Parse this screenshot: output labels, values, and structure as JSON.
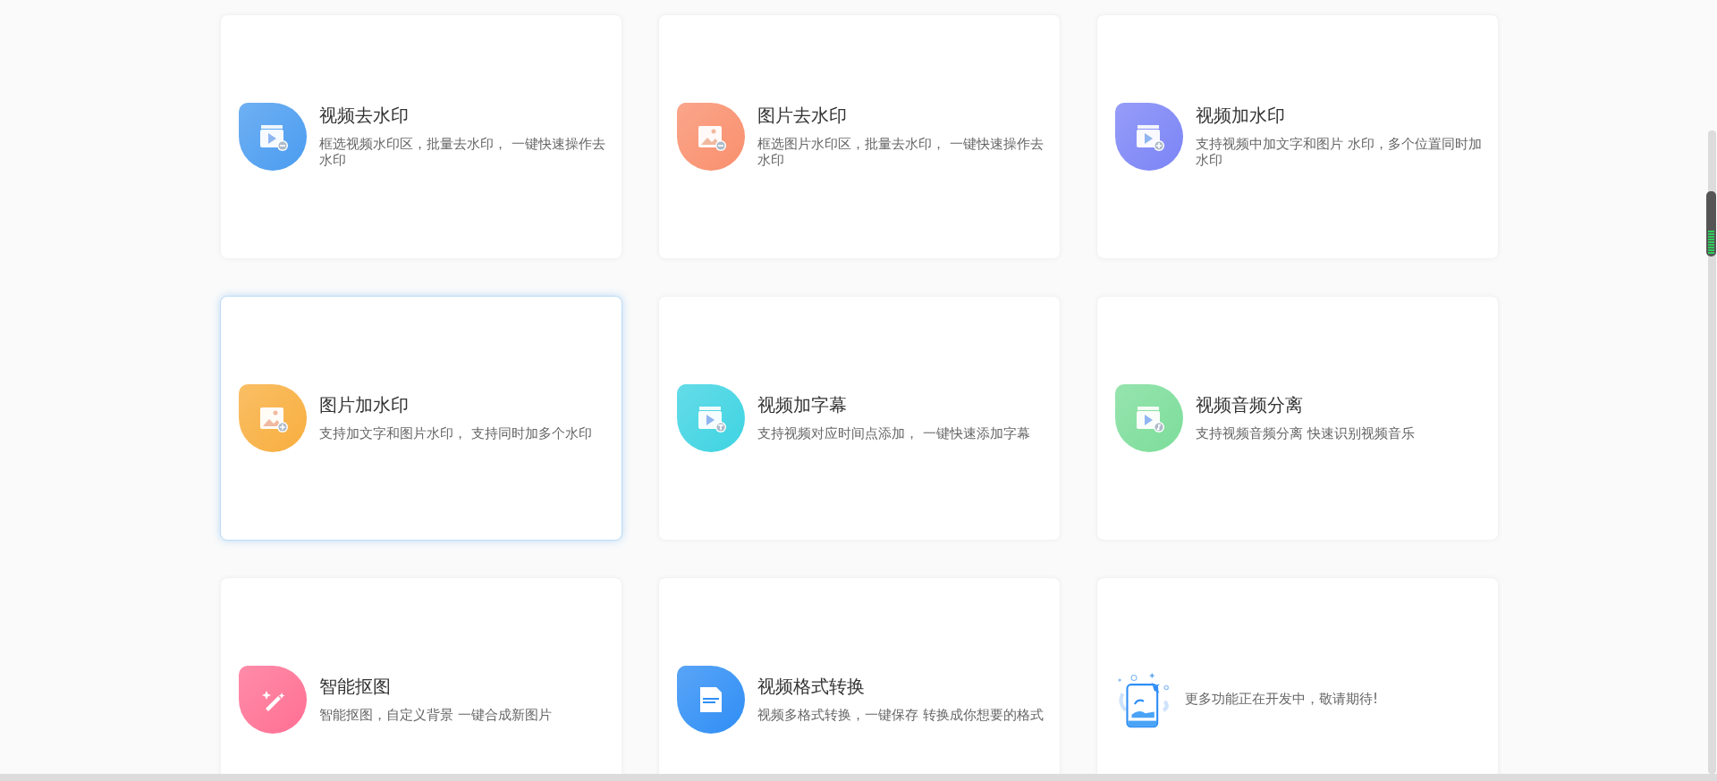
{
  "cards": [
    {
      "kind": "video_minus",
      "color": "#4a9cf0",
      "title": "视频去水印",
      "description": "框选视频水印区，批量去水印， 一键快速操作去水印",
      "selected": false
    },
    {
      "kind": "image_minus",
      "color": "#f98f6d",
      "title": "图片去水印",
      "description": "框选图片水印区，批量去水印， 一键快速操作去水印",
      "selected": false
    },
    {
      "kind": "video_plus",
      "color": "#7b84f6",
      "title": "视频加水印",
      "description": "支持视频中加文字和图片 水印，多个位置同时加水印",
      "selected": false
    },
    {
      "kind": "image_plus",
      "color": "#f8ae3e",
      "title": "图片加水印",
      "description": "支持加文字和图片水印， 支持同时加多个水印",
      "selected": true
    },
    {
      "kind": "video_text",
      "color": "#3ed3e2",
      "title": "视频加字幕",
      "description": "支持视频对应时间点添加， 一键快速添加字幕",
      "selected": false
    },
    {
      "kind": "video_music",
      "color": "#7cdd9a",
      "title": "视频音频分离",
      "description": "支持视频音频分离 快速识别视频音乐",
      "selected": false
    },
    {
      "kind": "wand",
      "color": "#ff6f93",
      "title": "智能抠图",
      "description": "智能抠图，自定义背景 一键合成新图片",
      "selected": false
    },
    {
      "kind": "mp4",
      "color": "#2f8ef5",
      "title": "视频格式转换",
      "description": "视频多格式转换，一键保存 转换成你想要的格式",
      "selected": false
    },
    {
      "kind": "coming",
      "description": "更多功能正在开发中，敬请期待!",
      "selected": false
    }
  ]
}
